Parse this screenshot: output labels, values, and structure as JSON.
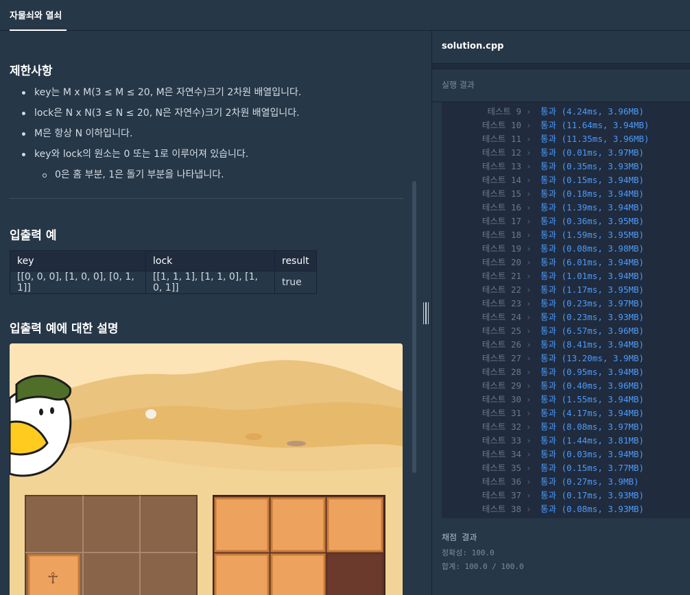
{
  "header": {
    "tab_title": "자물쇠와 열쇠"
  },
  "problem": {
    "constraints_title": "제한사항",
    "constraints": [
      "key는 M x M(3 ≤ M ≤ 20, M은 자연수)크기 2차원 배열입니다.",
      "lock은 N x N(3 ≤ N ≤ 20, N은 자연수)크기 2차원 배열입니다.",
      "M은 항상 N 이하입니다.",
      "key와 lock의 원소는 0 또는 1로 이루어져 있습니다."
    ],
    "sub_constraint": "0은 홈 부분, 1은 돌기 부분을 나타냅니다.",
    "io_title": "입출력 예",
    "io_table": {
      "headers": [
        "key",
        "lock",
        "result"
      ],
      "rows": [
        [
          "[[0, 0, 0], [1, 0, 0], [0, 1, 1]]",
          "[[1, 1, 1], [1, 1, 0], [1, 0, 1]]",
          "true"
        ]
      ]
    },
    "explanation_title": "입출력 예에 대한 설명"
  },
  "editor": {
    "file_name": "solution.cpp",
    "run_result_label": "실행 결과"
  },
  "results": [
    {
      "name": "테스트 9",
      "status": "통과 (4.24ms, 3.96MB)"
    },
    {
      "name": "테스트 10",
      "status": "통과 (11.64ms, 3.94MB)"
    },
    {
      "name": "테스트 11",
      "status": "통과 (11.35ms, 3.96MB)"
    },
    {
      "name": "테스트 12",
      "status": "통과 (0.01ms, 3.97MB)"
    },
    {
      "name": "테스트 13",
      "status": "통과 (0.35ms, 3.93MB)"
    },
    {
      "name": "테스트 14",
      "status": "통과 (0.15ms, 3.94MB)"
    },
    {
      "name": "테스트 15",
      "status": "통과 (0.18ms, 3.94MB)"
    },
    {
      "name": "테스트 16",
      "status": "통과 (1.39ms, 3.94MB)"
    },
    {
      "name": "테스트 17",
      "status": "통과 (0.36ms, 3.95MB)"
    },
    {
      "name": "테스트 18",
      "status": "통과 (1.59ms, 3.95MB)"
    },
    {
      "name": "테스트 19",
      "status": "통과 (0.08ms, 3.98MB)"
    },
    {
      "name": "테스트 20",
      "status": "통과 (6.01ms, 3.94MB)"
    },
    {
      "name": "테스트 21",
      "status": "통과 (1.01ms, 3.94MB)"
    },
    {
      "name": "테스트 22",
      "status": "통과 (1.17ms, 3.95MB)"
    },
    {
      "name": "테스트 23",
      "status": "통과 (0.23ms, 3.97MB)"
    },
    {
      "name": "테스트 24",
      "status": "통과 (0.23ms, 3.93MB)"
    },
    {
      "name": "테스트 25",
      "status": "통과 (6.57ms, 3.96MB)"
    },
    {
      "name": "테스트 26",
      "status": "통과 (8.41ms, 3.94MB)"
    },
    {
      "name": "테스트 27",
      "status": "통과 (13.20ms, 3.9MB)"
    },
    {
      "name": "테스트 28",
      "status": "통과 (0.95ms, 3.94MB)"
    },
    {
      "name": "테스트 29",
      "status": "통과 (0.40ms, 3.96MB)"
    },
    {
      "name": "테스트 30",
      "status": "통과 (1.55ms, 3.94MB)"
    },
    {
      "name": "테스트 31",
      "status": "통과 (4.17ms, 3.94MB)"
    },
    {
      "name": "테스트 32",
      "status": "통과 (8.08ms, 3.97MB)"
    },
    {
      "name": "테스트 33",
      "status": "통과 (1.44ms, 3.81MB)"
    },
    {
      "name": "테스트 34",
      "status": "통과 (0.03ms, 3.94MB)"
    },
    {
      "name": "테스트 35",
      "status": "통과 (0.15ms, 3.77MB)"
    },
    {
      "name": "테스트 36",
      "status": "통과 (0.27ms, 3.9MB)"
    },
    {
      "name": "테스트 37",
      "status": "통과 (0.17ms, 3.93MB)"
    },
    {
      "name": "테스트 38",
      "status": "통과 (0.08ms, 3.93MB)"
    }
  ],
  "grading": {
    "title": "채점 결과",
    "accuracy": "정확성: 100.0",
    "total": "합계: 100.0 / 100.0"
  },
  "colors": {
    "pass": "#4a9bff",
    "background": "#263747",
    "console_bg": "#202b3d"
  }
}
